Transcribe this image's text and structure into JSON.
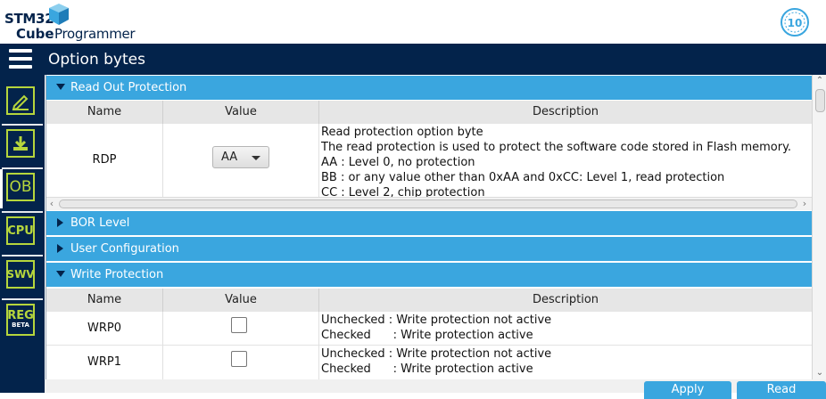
{
  "app": {
    "logo_line1": "STM32",
    "logo_cube": "Cube",
    "logo_programmer": "Programmer",
    "badge_text": "10"
  },
  "page_title": "Option bytes",
  "rail": {
    "items": [
      {
        "name": "memory-edit",
        "label": ""
      },
      {
        "name": "download",
        "label": ""
      },
      {
        "name": "option-bytes",
        "label": "OB"
      },
      {
        "name": "cpu",
        "label": "CPU"
      },
      {
        "name": "swv",
        "label": "SWV"
      },
      {
        "name": "registers",
        "label": "REG",
        "sub": "BETA"
      }
    ]
  },
  "columns": {
    "name": "Name",
    "value": "Value",
    "description": "Description"
  },
  "sections": {
    "read_out": "Read Out Protection",
    "bor": "BOR Level",
    "user_config": "User Configuration",
    "write_protection": "Write Protection"
  },
  "rdp": {
    "name": "RDP",
    "value": "AA",
    "desc": [
      "Read protection option byte",
      "The read protection is used to protect the software code stored in Flash memory.",
      "AA : Level 0, no protection",
      "BB : or any value other than 0xAA and 0xCC: Level 1, read protection",
      "CC : Level 2, chip protection"
    ]
  },
  "wrp": [
    {
      "name": "WRP0",
      "unchecked": "Unchecked : Write protection not active",
      "checked": "Checked      : Write protection active"
    },
    {
      "name": "WRP1",
      "unchecked": "Unchecked : Write protection not active",
      "checked": "Checked      : Write protection active"
    }
  ],
  "buttons": {
    "apply": "Apply",
    "read": "Read"
  },
  "colors": {
    "navy": "#03234b",
    "accent": "#3aa6df",
    "lime": "#b6d63c"
  }
}
